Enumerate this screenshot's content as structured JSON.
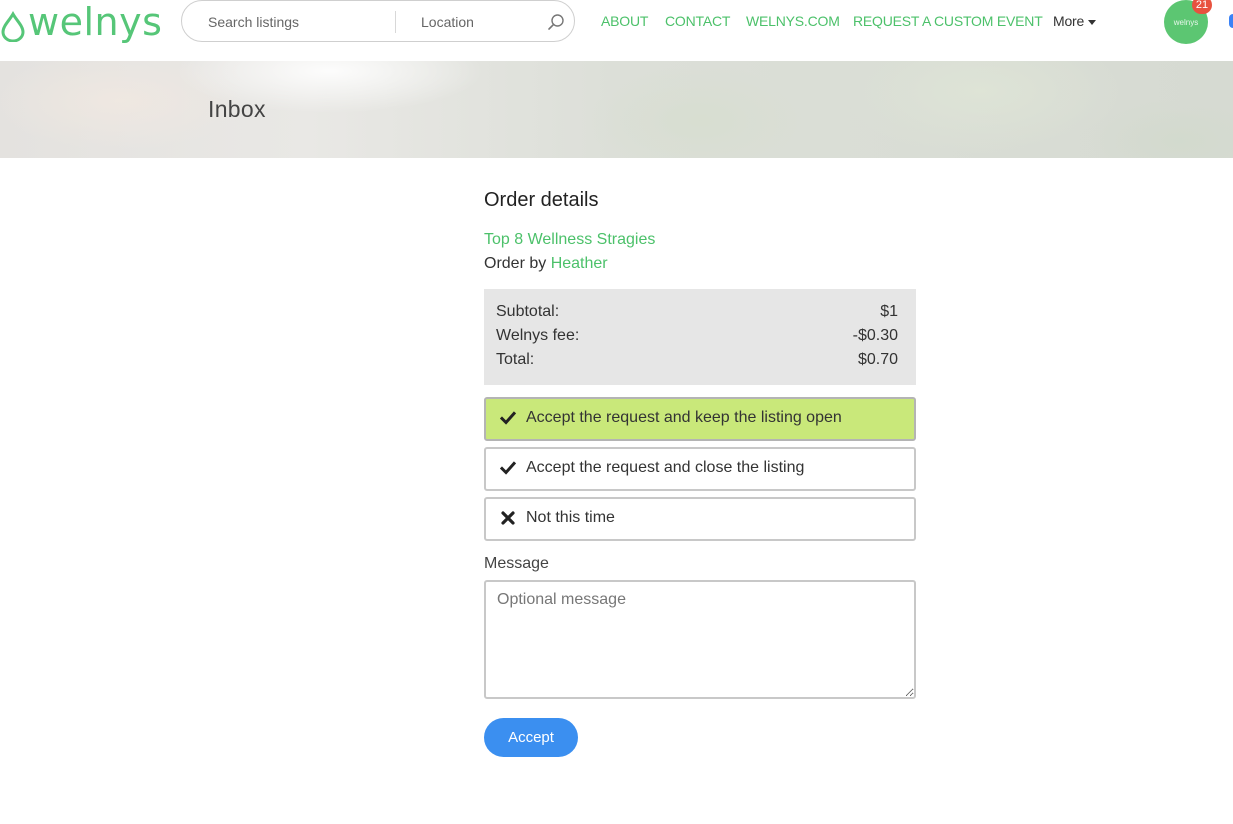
{
  "brand": {
    "name": "welnys",
    "accent": "#4cc16a"
  },
  "search": {
    "keyword_placeholder": "Search listings",
    "location_placeholder": "Location",
    "icon": "search-icon"
  },
  "nav": {
    "about": "ABOUT",
    "contact": "CONTACT",
    "site": "WELNYS.COM",
    "custom_event": "REQUEST A CUSTOM EVENT",
    "more": "More"
  },
  "user": {
    "avatar_text": "welnys",
    "notification_count": "21"
  },
  "hero": {
    "title": "Inbox"
  },
  "order": {
    "heading": "Order details",
    "listing_title": "Top 8 Wellness Stragies",
    "order_by_prefix": "Order by",
    "customer_name": "Heather",
    "breakdown": [
      {
        "label": "Subtotal:",
        "value": "$1"
      },
      {
        "label": "Welnys fee:",
        "value": "-$0.30"
      },
      {
        "label": "Total:",
        "value": "$0.70"
      }
    ],
    "choices": [
      {
        "label": "Accept the request and keep the listing open",
        "icon": "check-icon",
        "selected": true
      },
      {
        "label": "Accept the request and close the listing",
        "icon": "check-icon",
        "selected": false
      },
      {
        "label": "Not this time",
        "icon": "x-icon",
        "selected": false
      }
    ],
    "message_label": "Message",
    "message_placeholder": "Optional message",
    "submit_label": "Accept"
  },
  "colors": {
    "selected_choice": "#c9e87a",
    "primary_button": "#3b8ff0",
    "badge": "#e8523f",
    "avatar": "#5cc672"
  }
}
